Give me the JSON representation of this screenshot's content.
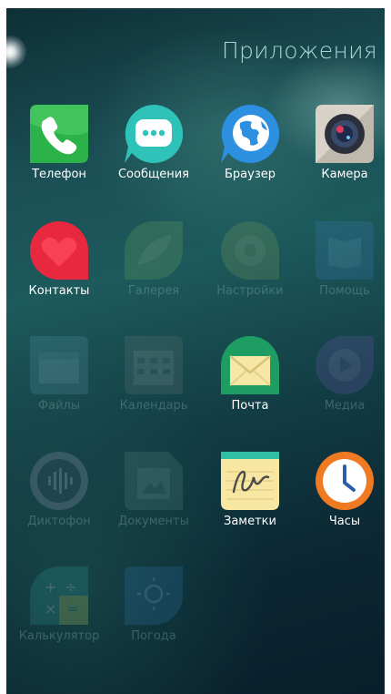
{
  "screen": {
    "title": "Приложения"
  },
  "apps": [
    {
      "label": "Телефон",
      "icon": "phone-icon",
      "active": true
    },
    {
      "label": "Сообщения",
      "icon": "messages-icon",
      "active": true
    },
    {
      "label": "Браузер",
      "icon": "browser-icon",
      "active": true
    },
    {
      "label": "Камера",
      "icon": "camera-icon",
      "active": true
    },
    {
      "label": "Контакты",
      "icon": "contacts-icon",
      "active": true
    },
    {
      "label": "Галерея",
      "icon": "gallery-icon",
      "active": false
    },
    {
      "label": "Настройки",
      "icon": "settings-icon",
      "active": false
    },
    {
      "label": "Помощь",
      "icon": "help-icon",
      "active": false
    },
    {
      "label": "Файлы",
      "icon": "files-icon",
      "active": false
    },
    {
      "label": "Календарь",
      "icon": "calendar-icon",
      "active": false
    },
    {
      "label": "Почта",
      "icon": "mail-icon",
      "active": true
    },
    {
      "label": "Медиа",
      "icon": "media-icon",
      "active": false
    },
    {
      "label": "Диктофон",
      "icon": "recorder-icon",
      "active": false
    },
    {
      "label": "Документы",
      "icon": "documents-icon",
      "active": false
    },
    {
      "label": "Заметки",
      "icon": "notes-icon",
      "active": true
    },
    {
      "label": "Часы",
      "icon": "clock-icon",
      "active": true
    },
    {
      "label": "Калькулятор",
      "icon": "calculator-icon",
      "active": false
    },
    {
      "label": "Погода",
      "icon": "weather-icon",
      "active": false
    }
  ],
  "colors": {
    "title": "#a9d8d4",
    "phone": "#2bb34a",
    "messages": "#2fc2b8",
    "browser": "#2d8fe0",
    "contacts": "#e8283f",
    "mail": "#1e9d63",
    "clock": "#f07a22"
  }
}
